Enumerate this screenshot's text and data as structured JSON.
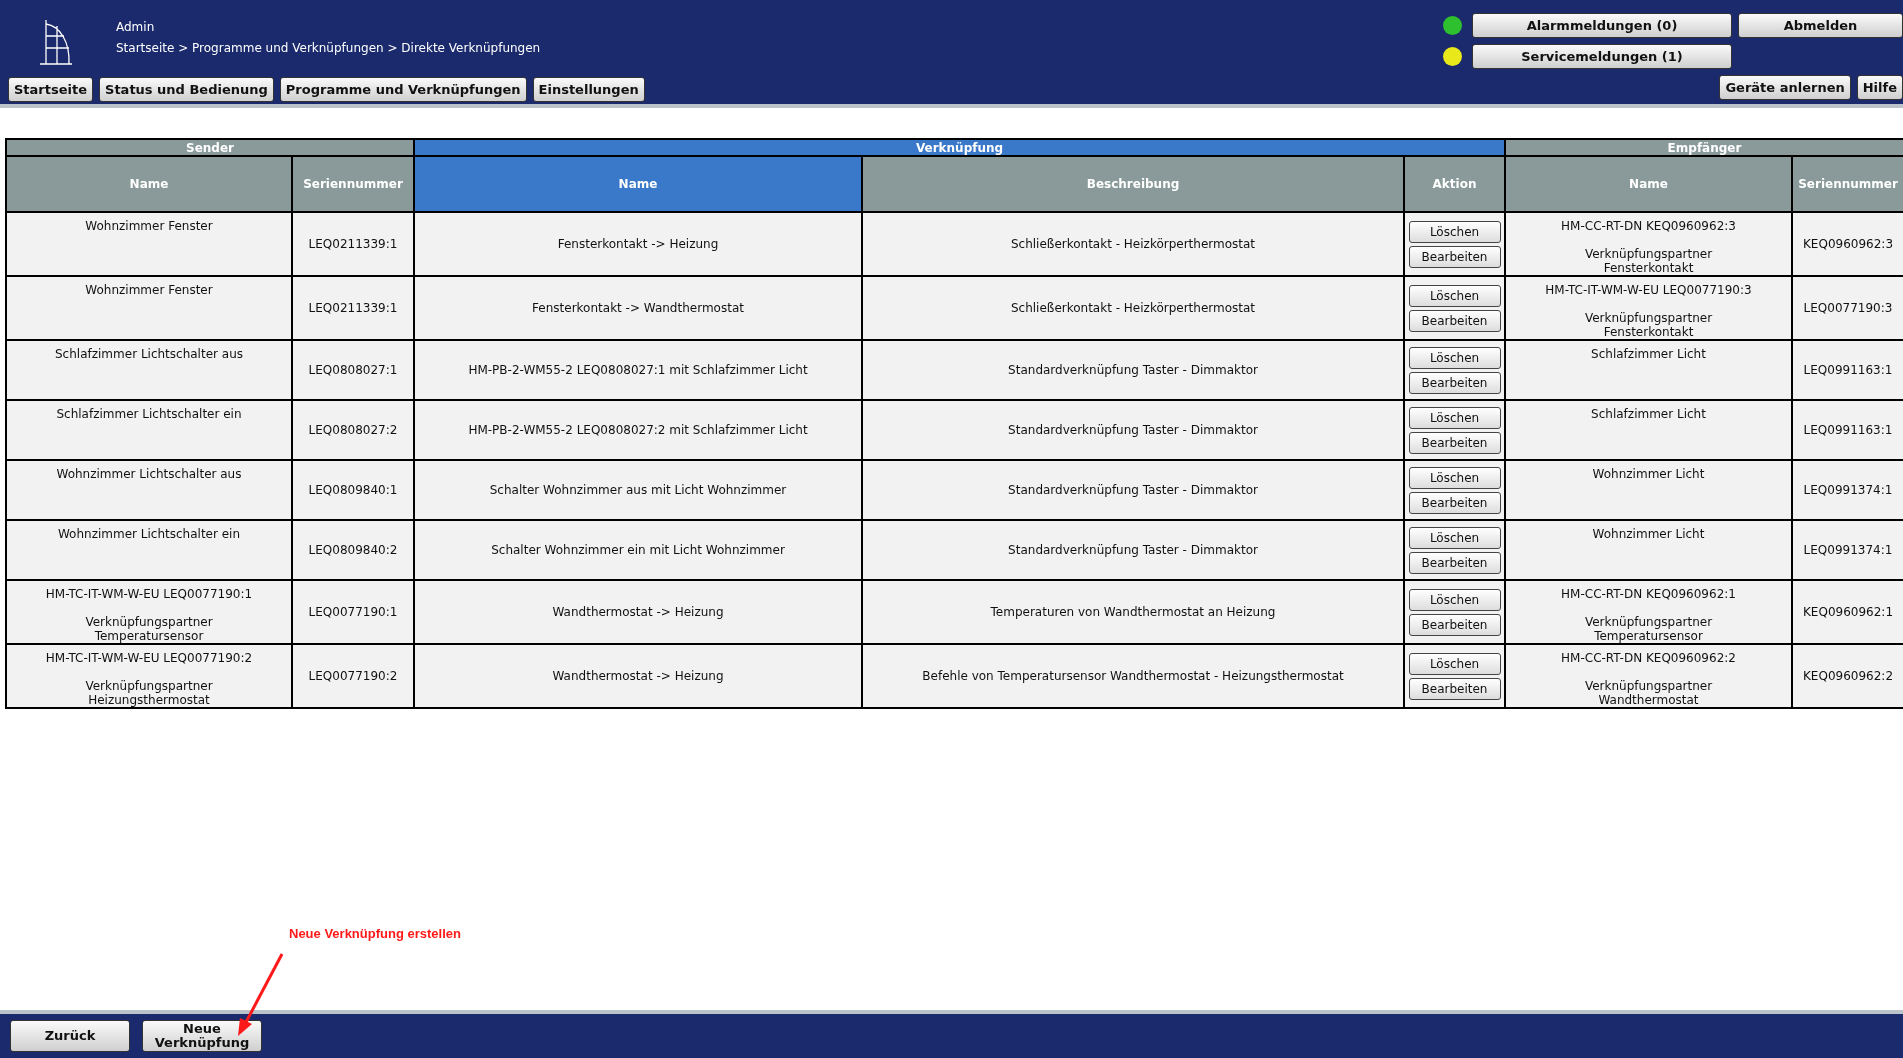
{
  "header": {
    "user": "Admin",
    "breadcrumb": "Startseite > Programme und Verknüpfungen > Direkte Verknüpfungen"
  },
  "nav": [
    "Startseite",
    "Status und Bedienung",
    "Programme und Verknüpfungen",
    "Einstellungen"
  ],
  "messages": [
    {
      "label": "Alarmmeldungen (0)",
      "color": "#2ec02e"
    },
    {
      "label": "Servicemeldungen (1)",
      "color": "#e8e81a"
    }
  ],
  "logout": "Abmelden",
  "right_nav": [
    "Geräte anlernen",
    "Hilfe"
  ],
  "table": {
    "groups": [
      {
        "label": "Sender",
        "highlighted": false,
        "columns": [
          {
            "label": "Name",
            "highlighted": false
          },
          {
            "label": "Seriennummer",
            "highlighted": false
          }
        ]
      },
      {
        "label": "Verknüpfung",
        "highlighted": true,
        "columns": [
          {
            "label": "Name",
            "highlighted": true
          },
          {
            "label": "Beschreibung",
            "highlighted": false
          },
          {
            "label": "Aktion",
            "highlighted": false
          }
        ]
      },
      {
        "label": "Empfänger",
        "highlighted": false,
        "columns": [
          {
            "label": "Name",
            "highlighted": false
          },
          {
            "label": "Seriennummer",
            "highlighted": false
          }
        ]
      }
    ],
    "rows": [
      {
        "sender_name": "Wohnzimmer Fenster",
        "sender_serial": "LEQ0211339:1",
        "link_name": "Fensterkontakt -> Heizung",
        "description": "Schließerkontakt - Heizkörperthermostat",
        "actions": [
          "Löschen",
          "Bearbeiten"
        ],
        "receiver_name": "HM-CC-RT-DN KEQ0960962:3\n\nVerknüpfungspartner\nFensterkontakt",
        "receiver_serial": "KEQ0960962:3"
      },
      {
        "sender_name": "Wohnzimmer Fenster",
        "sender_serial": "LEQ0211339:1",
        "link_name": "Fensterkontakt -> Wandthermostat",
        "description": "Schließerkontakt - Heizkörperthermostat",
        "actions": [
          "Löschen",
          "Bearbeiten"
        ],
        "receiver_name": "HM-TC-IT-WM-W-EU LEQ0077190:3\n\nVerknüpfungspartner\nFensterkontakt",
        "receiver_serial": "LEQ0077190:3"
      },
      {
        "sender_name": "Schlafzimmer Lichtschalter aus",
        "sender_serial": "LEQ0808027:1",
        "link_name": "HM-PB-2-WM55-2 LEQ0808027:1 mit Schlafzimmer Licht",
        "description": "Standardverknüpfung Taster - Dimmaktor",
        "actions": [
          "Löschen",
          "Bearbeiten"
        ],
        "receiver_name": "Schlafzimmer Licht",
        "receiver_serial": "LEQ0991163:1"
      },
      {
        "sender_name": "Schlafzimmer Lichtschalter ein",
        "sender_serial": "LEQ0808027:2",
        "link_name": "HM-PB-2-WM55-2 LEQ0808027:2 mit Schlafzimmer Licht",
        "description": "Standardverknüpfung Taster - Dimmaktor",
        "actions": [
          "Löschen",
          "Bearbeiten"
        ],
        "receiver_name": "Schlafzimmer Licht",
        "receiver_serial": "LEQ0991163:1"
      },
      {
        "sender_name": "Wohnzimmer Lichtschalter aus",
        "sender_serial": "LEQ0809840:1",
        "link_name": "Schalter Wohnzimmer aus mit Licht Wohnzimmer",
        "description": "Standardverknüpfung Taster - Dimmaktor",
        "actions": [
          "Löschen",
          "Bearbeiten"
        ],
        "receiver_name": "Wohnzimmer Licht",
        "receiver_serial": "LEQ0991374:1"
      },
      {
        "sender_name": "Wohnzimmer Lichtschalter ein",
        "sender_serial": "LEQ0809840:2",
        "link_name": "Schalter Wohnzimmer ein mit Licht Wohnzimmer",
        "description": "Standardverknüpfung Taster - Dimmaktor",
        "actions": [
          "Löschen",
          "Bearbeiten"
        ],
        "receiver_name": "Wohnzimmer Licht",
        "receiver_serial": "LEQ0991374:1"
      },
      {
        "sender_name": "HM-TC-IT-WM-W-EU LEQ0077190:1\n\nVerknüpfungspartner\nTemperatursensor",
        "sender_serial": "LEQ0077190:1",
        "link_name": "Wandthermostat -> Heizung",
        "description": "Temperaturen von Wandthermostat an Heizung",
        "actions": [
          "Löschen",
          "Bearbeiten"
        ],
        "receiver_name": "HM-CC-RT-DN KEQ0960962:1\n\nVerknüpfungspartner\nTemperatursensor",
        "receiver_serial": "KEQ0960962:1"
      },
      {
        "sender_name": "HM-TC-IT-WM-W-EU LEQ0077190:2\n\nVerknüpfungspartner\nHeizungsthermostat",
        "sender_serial": "LEQ0077190:2",
        "link_name": "Wandthermostat -> Heizung",
        "description": "Befehle von Temperatursensor Wandthermostat - Heizungsthermostat",
        "actions": [
          "Löschen",
          "Bearbeiten"
        ],
        "receiver_name": "HM-CC-RT-DN KEQ0960962:2\n\nVerknüpfungspartner\nWandthermostat",
        "receiver_serial": "KEQ0960962:2"
      }
    ]
  },
  "annotation": "Neue Verknüpfung erstellen",
  "footer": [
    "Zurück",
    "Neue Verknüpfung"
  ]
}
